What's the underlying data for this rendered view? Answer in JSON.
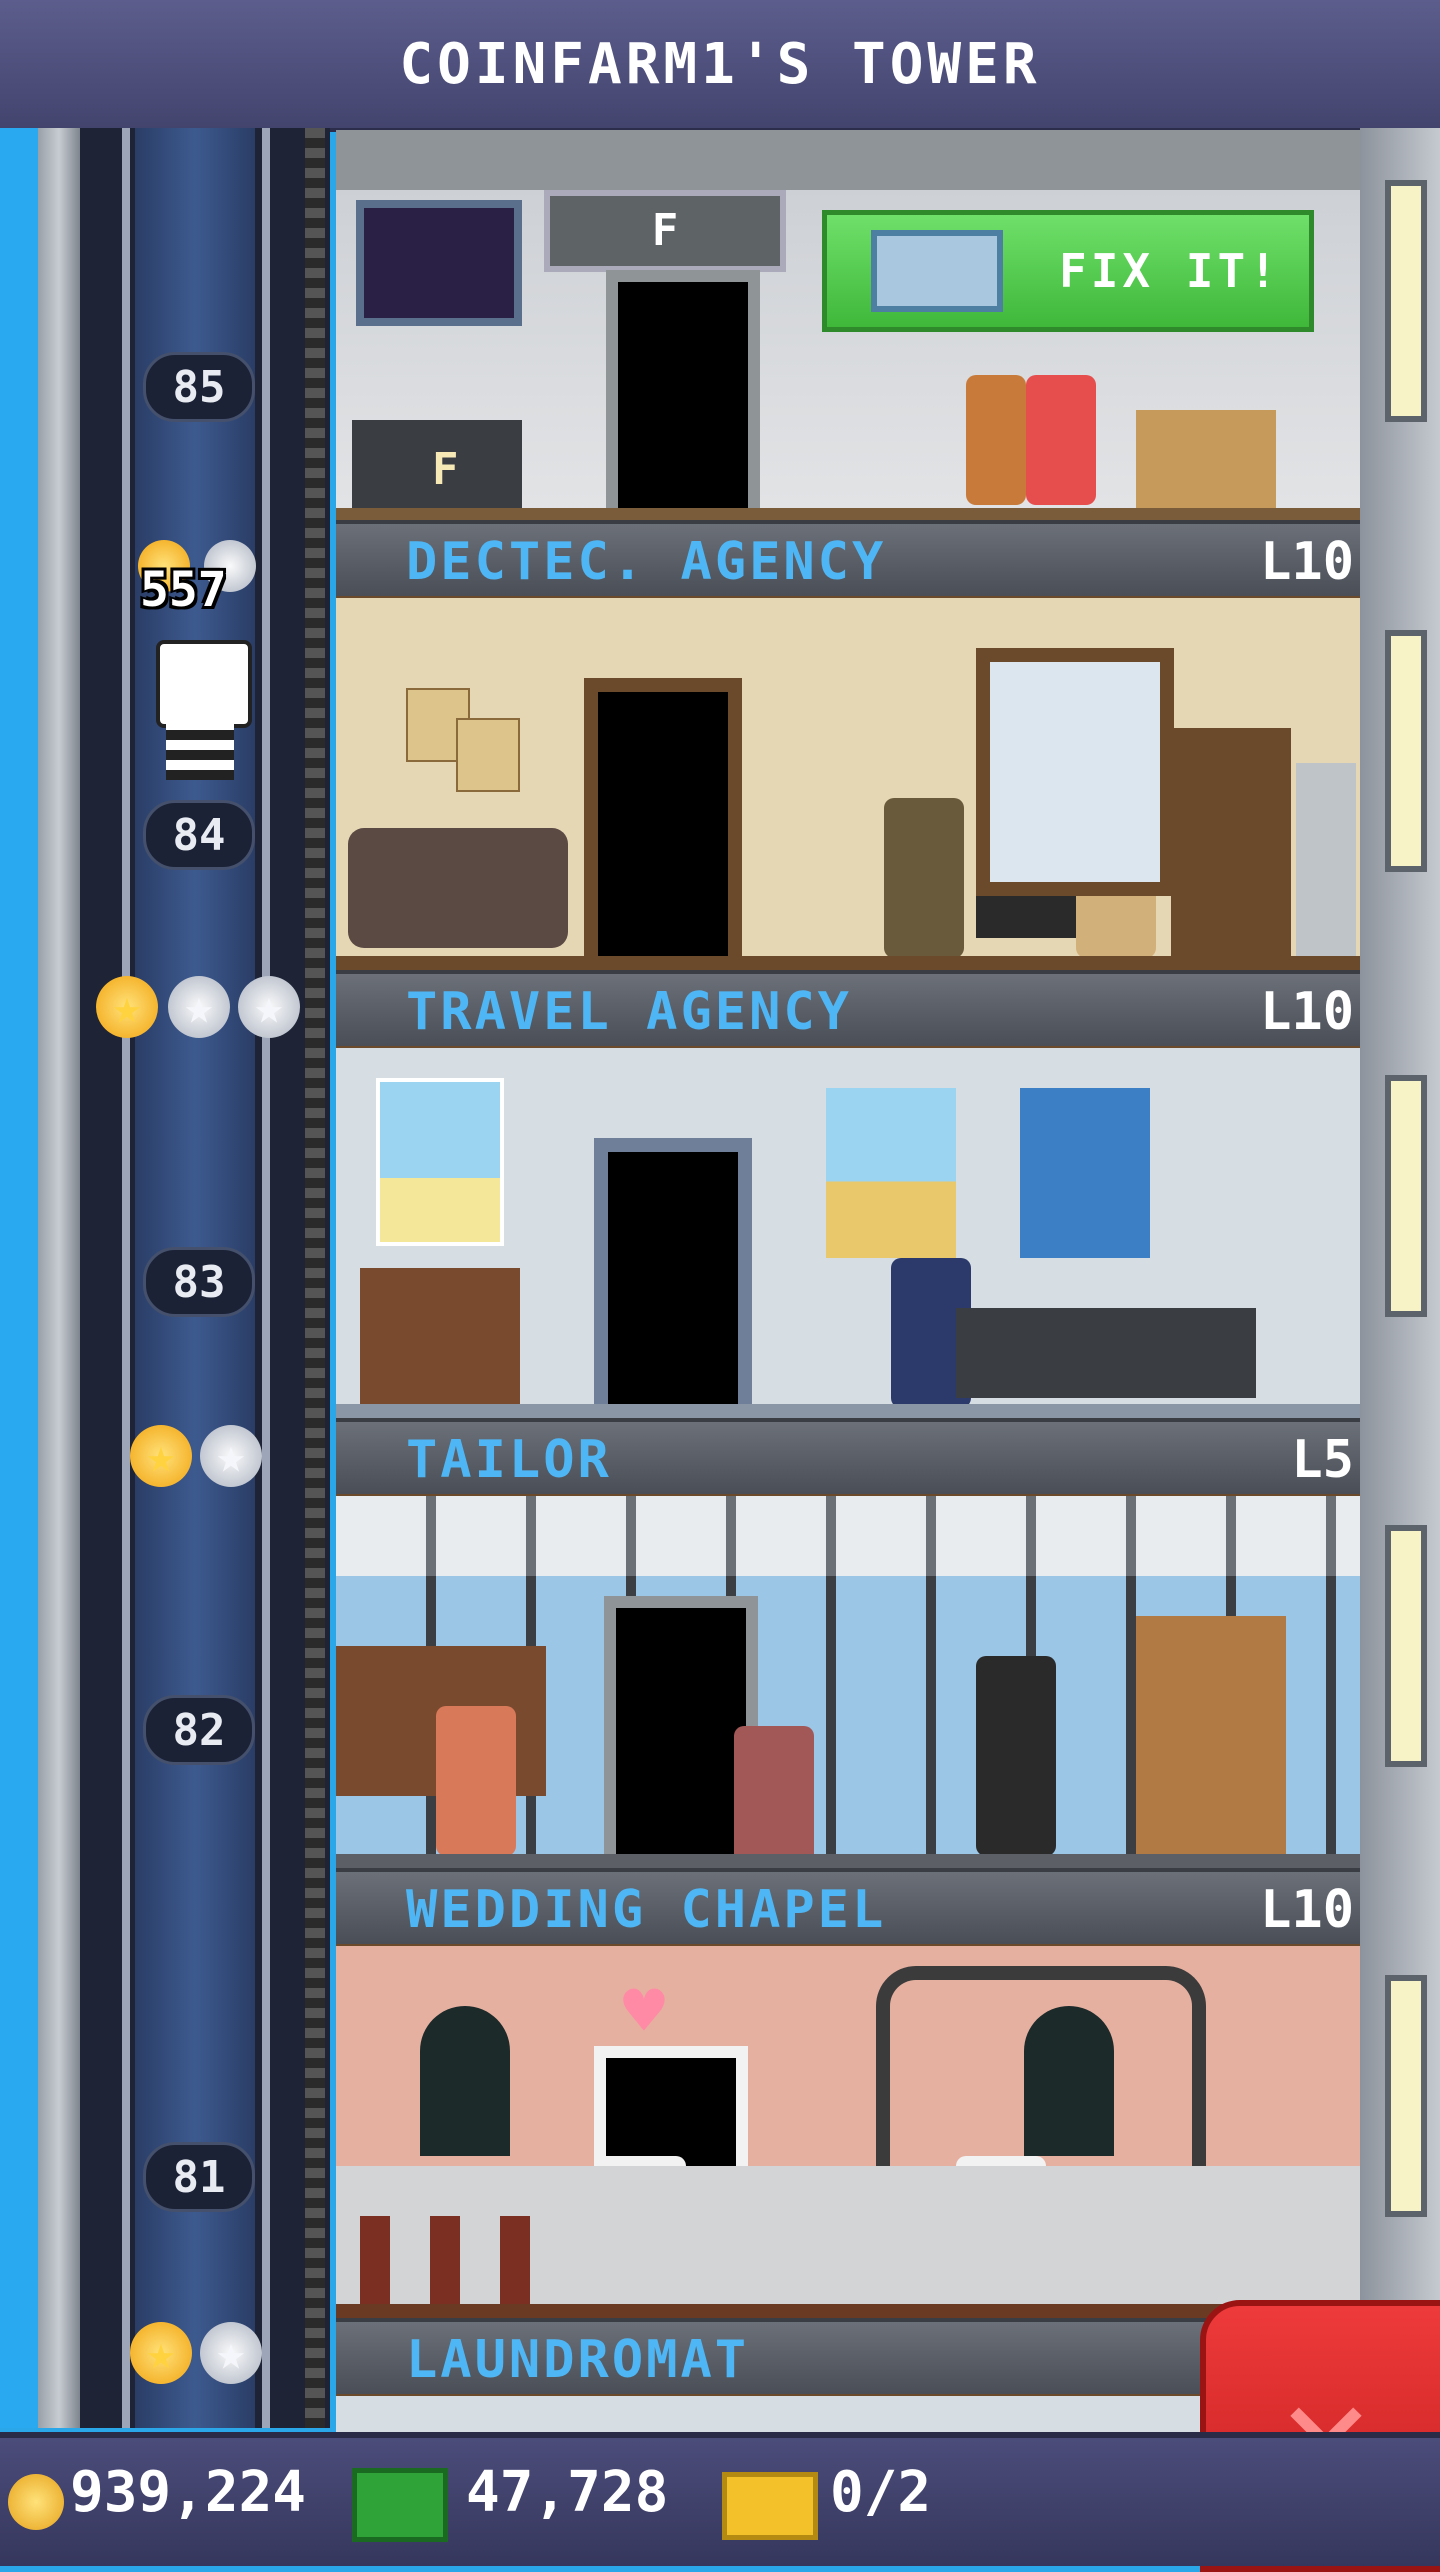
{
  "title": "COINFARM1'S TOWER",
  "floors": [
    {
      "number": "85"
    },
    {
      "number": "84"
    },
    {
      "number": "83"
    },
    {
      "number": "82"
    },
    {
      "number": "81"
    }
  ],
  "elevator": {
    "passenger_count": "557"
  },
  "rooms": [
    {
      "name": "DECTEC. AGENCY",
      "level": "L10"
    },
    {
      "name": "TRAVEL AGENCY",
      "level": "L10"
    },
    {
      "name": "TAILOR",
      "level": "L5"
    },
    {
      "name": "WEDDING CHAPEL",
      "level": "L10"
    },
    {
      "name": "LAUNDROMAT",
      "level": ""
    }
  ],
  "top_room": {
    "fix_label": "FIX IT!",
    "sign_letter": "F"
  },
  "hud": {
    "coins": "939,224",
    "bux": "47,728",
    "tickets": "0/2"
  },
  "icons": [
    "coin-icon",
    "bux-icon",
    "ticket-icon",
    "close-icon",
    "star-icon"
  ],
  "colors": {
    "room_label": "#4fb6f5",
    "fix_button": "#4fc54a",
    "close_button": "#e23030",
    "top_bar": "#4d4e7c"
  }
}
